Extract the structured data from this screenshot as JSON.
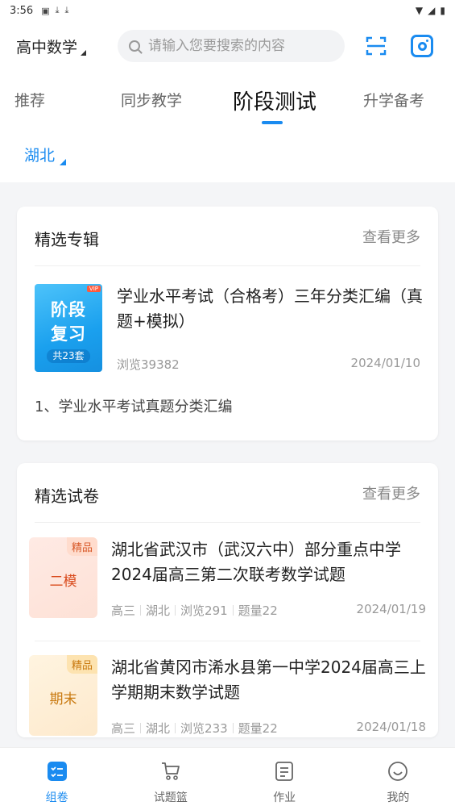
{
  "status_bar": {
    "time": "3:56",
    "icons": [
      "a-icon",
      "download-icon",
      "download-icon"
    ],
    "right_icons": [
      "wifi-icon",
      "signal-icon",
      "battery-icon"
    ]
  },
  "header": {
    "subject": "高中数学",
    "search_placeholder": "请输入您要搜索的内容"
  },
  "tabs": [
    {
      "label": "推荐",
      "active": false
    },
    {
      "label": "同步教学",
      "active": false
    },
    {
      "label": "阶段测试",
      "active": true
    },
    {
      "label": "升学备考",
      "active": false
    }
  ],
  "region": "湖北",
  "featured_albums": {
    "title": "精选专辑",
    "more_label": "查看更多",
    "items": [
      {
        "cover": {
          "vip": "VIP",
          "line1": "阶段",
          "line2": "复习",
          "count": "共23套"
        },
        "title": "学业水平考试（合格考）三年分类汇编（真题+模拟）",
        "views": "浏览39382",
        "date": "2024/01/10",
        "description": "1、学业水平考试真题分类汇编"
      }
    ]
  },
  "featured_papers": {
    "title": "精选试卷",
    "more_label": "查看更多",
    "items": [
      {
        "cover": {
          "tag": "精品",
          "label": "二模"
        },
        "title": "湖北省武汉市（武汉六中）部分重点中学2024届高三第二次联考数学试题",
        "grade": "高三",
        "region": "湖北",
        "views": "浏览291",
        "questions": "题量22",
        "date": "2024/01/19"
      },
      {
        "cover": {
          "tag": "精品",
          "label": "期末"
        },
        "title": "湖北省黄冈市浠水县第一中学2024届高三上学期期末数学试题",
        "grade": "高三",
        "region": "湖北",
        "views": "浏览233",
        "questions": "题量22",
        "date": "2024/01/18"
      }
    ]
  },
  "bottom_nav": [
    {
      "label": "组卷",
      "icon": "compose-icon",
      "active": true
    },
    {
      "label": "试题篮",
      "icon": "cart-icon",
      "active": false
    },
    {
      "label": "作业",
      "icon": "homework-icon",
      "active": false
    },
    {
      "label": "我的",
      "icon": "profile-icon",
      "active": false
    }
  ],
  "colors": {
    "accent": "#1a8bf0",
    "background": "#f4f5f7"
  }
}
